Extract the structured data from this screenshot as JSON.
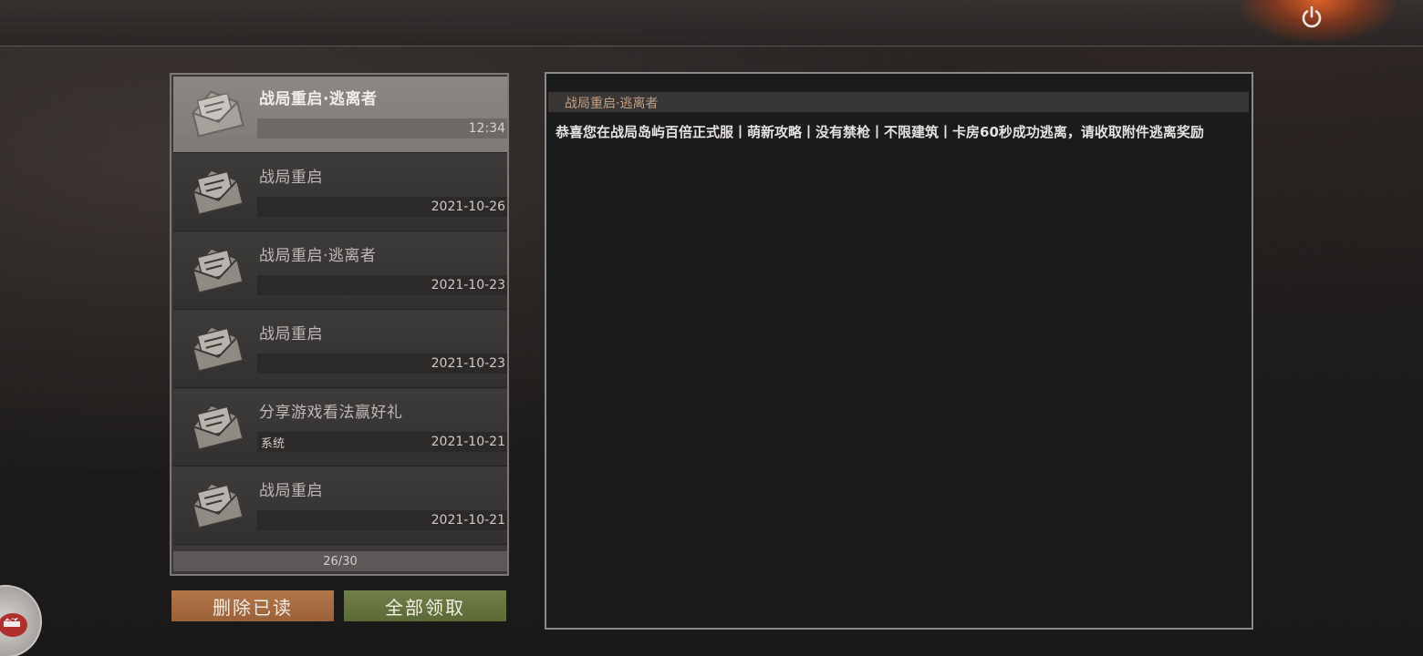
{
  "mail_list": {
    "items": [
      {
        "title": "战局重启·逃离者",
        "date": "12:34",
        "sender": "",
        "selected": true
      },
      {
        "title": "战局重启",
        "date": "2021-10-26",
        "sender": ""
      },
      {
        "title": "战局重启·逃离者",
        "date": "2021-10-23",
        "sender": ""
      },
      {
        "title": "战局重启",
        "date": "2021-10-23",
        "sender": ""
      },
      {
        "title": "分享游戏看法赢好礼",
        "date": "2021-10-21",
        "sender": "系统"
      },
      {
        "title": "战局重启",
        "date": "2021-10-21",
        "sender": ""
      }
    ],
    "count": "26/30"
  },
  "buttons": {
    "delete_read": "删除已读",
    "claim_all": "全部领取"
  },
  "content": {
    "title": "战局重启·逃离者",
    "body": "恭喜您在战局岛屿百倍正式服丨萌新攻略丨没有禁枪丨不限建筑丨卡房60秒成功逃离，请收取附件逃离奖励"
  },
  "icons": {
    "mail": "open-envelope-icon",
    "power": "power-icon"
  },
  "colors": {
    "delete_button": "#a86a40",
    "claim_button": "#667545",
    "content_title": "#c09e84"
  }
}
